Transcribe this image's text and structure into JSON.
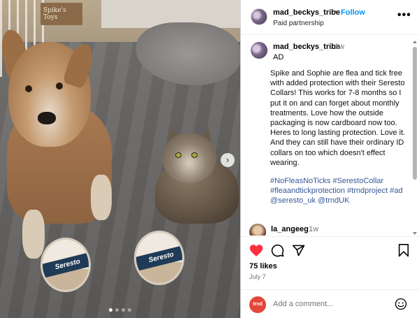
{
  "photo": {
    "box_text": "Spike's Toys",
    "collar_brand": "Seresto",
    "carousel": {
      "next_glyph": "›",
      "dots": 4,
      "active_dot": 0
    }
  },
  "post": {
    "username": "mad_beckys_tribe",
    "separator": "•",
    "follow_label": "Follow",
    "subtitle": "Paid partnership",
    "more_glyph": "•••"
  },
  "caption": {
    "username": "mad_beckys_tribe",
    "time": "1w",
    "tag": "AD",
    "body": "Spike and Sophie are flea and tick free with added protection with their Seresto Collars! This works for 7-8 months so I put it on and can forget about monthly treatments. Love how the outside packaging is now cardboard now too. Heres to long lasting protection. Love it. And they can still have their ordinary ID collars on too which doesn't effect wearing.",
    "hashtags": "#NoFleasNoTicks #SerestoCollar #fleaandtickprotection #trndproject #ad @seresto_uk @trndUK"
  },
  "comment": {
    "username": "la_angeeg",
    "time": "1w"
  },
  "actions": {
    "liked": true,
    "like_color": "#ff3040"
  },
  "stats": {
    "likes": "75 likes",
    "date": "July 7"
  },
  "comment_bar": {
    "avatar_text": "trnd",
    "avatar_color": "#e4473a",
    "placeholder": "Add a comment..."
  },
  "colors": {
    "link": "#0095f6",
    "hashtag": "#385898"
  }
}
